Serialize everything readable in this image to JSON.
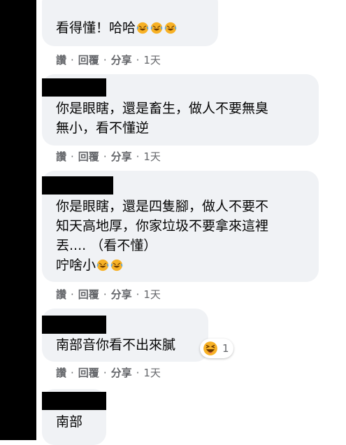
{
  "comments": [
    {
      "text_lines": [
        "看得懂！哈哈"
      ],
      "emoji_count": 3,
      "actions": {
        "like": "讚",
        "reply": "回覆",
        "share": "分享",
        "time": "1天"
      }
    },
    {
      "text_lines": [
        "你是眼瞎，還是畜生，做人不要無臭",
        "無小，看不懂逆"
      ],
      "actions": {
        "like": "讚",
        "reply": "回覆",
        "share": "分享",
        "time": "1天"
      }
    },
    {
      "text_lines": [
        "你是眼瞎，還是四隻腳，做人不要不",
        "知天高地厚，你家垃圾不要拿來這裡",
        "丟.... （看不懂）",
        "咛啥小"
      ],
      "emoji_count": 2,
      "actions": {
        "like": "讚",
        "reply": "回覆",
        "share": "分享",
        "time": "1天"
      }
    },
    {
      "text_lines": [
        "南部音你看不出來膩"
      ],
      "reaction": {
        "icon": "haha-emoji-icon",
        "count": "1"
      },
      "actions": {
        "like": "讚",
        "reply": "回覆",
        "share": "分享",
        "time": "1天"
      }
    },
    {
      "text_lines": [
        "南部"
      ]
    }
  ],
  "separator": "·",
  "colors": {
    "bubble": "#f0f2f5",
    "meta_text": "#65676b",
    "text": "#050505",
    "emoji_face": "#f7b125"
  }
}
